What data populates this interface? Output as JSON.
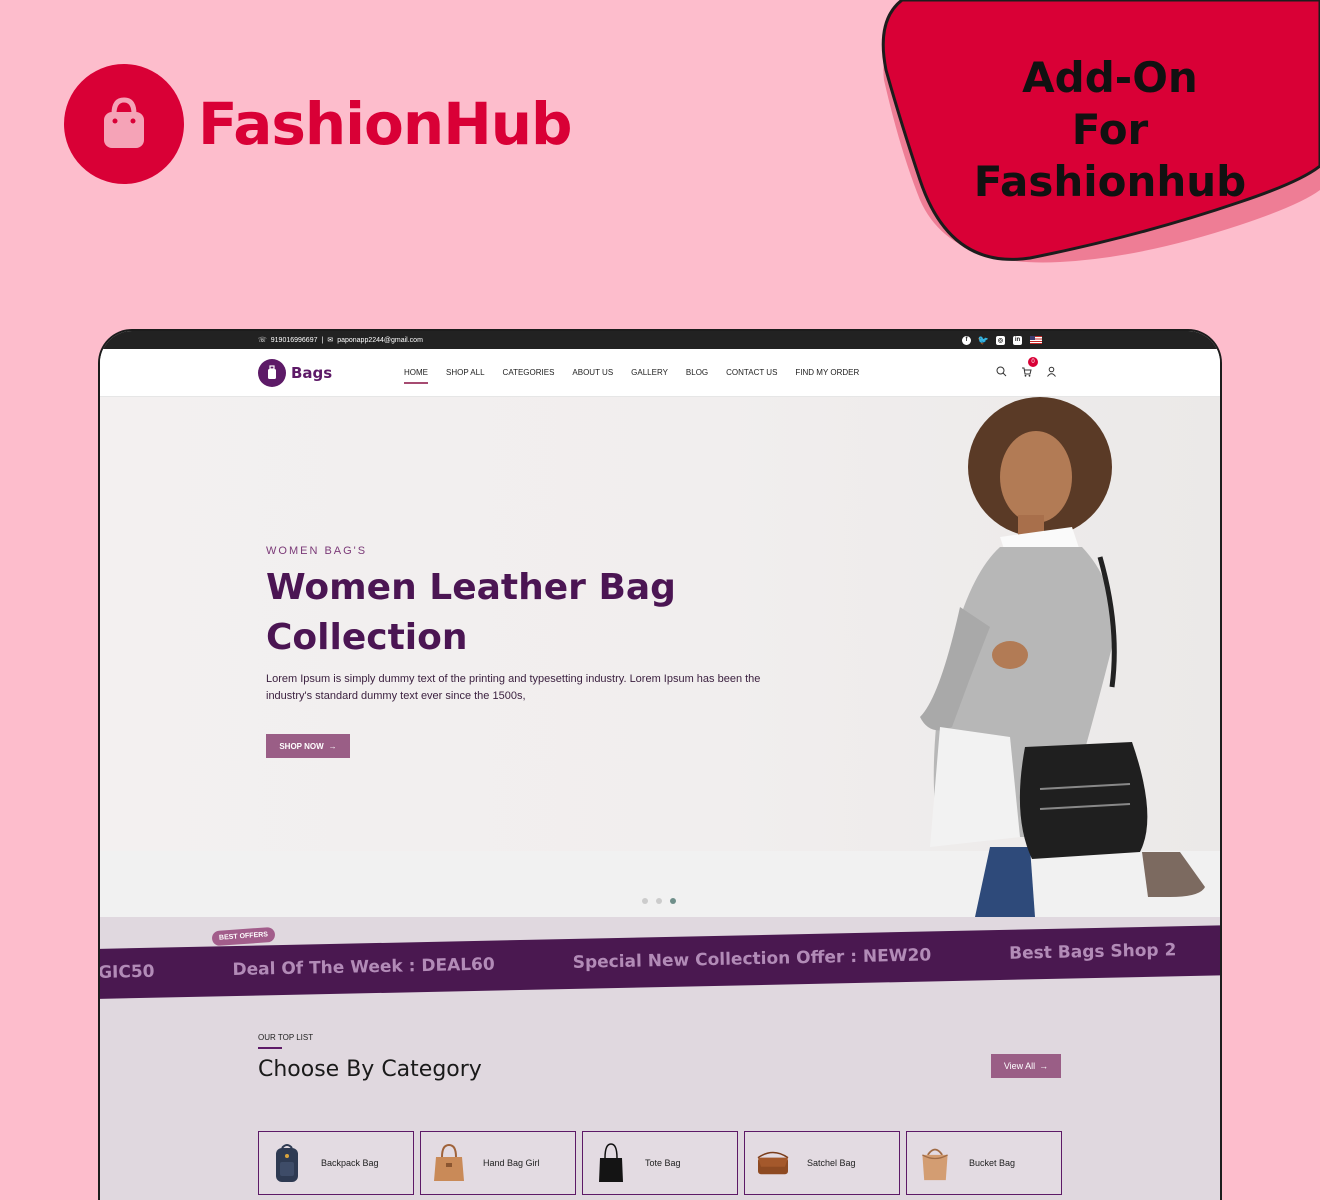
{
  "brand": {
    "name": "FashionHub",
    "badge_line1": "Add-On",
    "badge_line2": "For Fashionhub"
  },
  "topbar": {
    "phone": "919016996697",
    "email": "paponapp2244@gmail.com",
    "socials": [
      "facebook-icon",
      "twitter-icon",
      "instagram-icon",
      "linkedin-icon",
      "us-flag-icon"
    ]
  },
  "nav": {
    "logo_text": "Bags",
    "items": [
      {
        "label": "HOME",
        "active": true
      },
      {
        "label": "SHOP ALL"
      },
      {
        "label": "CATEGORIES"
      },
      {
        "label": "ABOUT US"
      },
      {
        "label": "GALLERY"
      },
      {
        "label": "BLOG"
      },
      {
        "label": "CONTACT US"
      },
      {
        "label": "FIND MY ORDER"
      }
    ],
    "cart_count": "0"
  },
  "hero": {
    "eyebrow": "WOMEN BAG'S",
    "title": "Women Leather Bag Collection",
    "description": "Lorem Ipsum is simply dummy text of the printing and typesetting industry. Lorem Ipsum has been the industry's standard dummy text ever since the 1500s,",
    "button": "SHOP NOW",
    "slides_total": 3,
    "slide_active": 3
  },
  "ticker": {
    "tag": "BEST OFFERS",
    "items": [
      "GIC50",
      "Deal Of The Week : DEAL60",
      "Special New Collection Offer : NEW20",
      "Best Bags Shop 2"
    ]
  },
  "category_section": {
    "eyebrow": "OUR TOP LIST",
    "title": "Choose By Category",
    "view_all": "View All",
    "categories": [
      {
        "label": "Backpack Bag"
      },
      {
        "label": "Hand Bag Girl"
      },
      {
        "label": "Tote Bag"
      },
      {
        "label": "Satchel Bag"
      },
      {
        "label": "Bucket Bag"
      }
    ]
  },
  "colors": {
    "brand_red": "#d90036",
    "plum": "#5d1a67",
    "mauve": "#9a5e86",
    "bg_pink": "#fdbdcc"
  }
}
